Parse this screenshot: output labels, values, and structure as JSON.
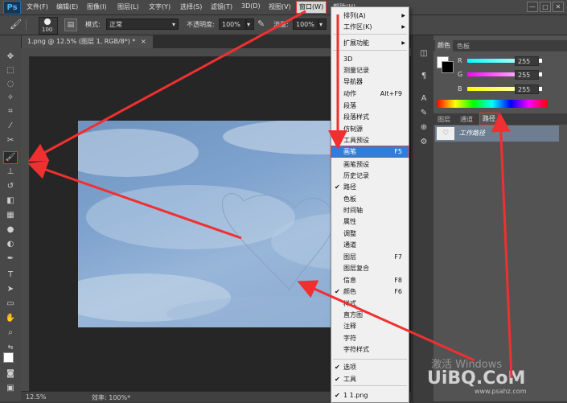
{
  "app": {
    "logo": "Ps"
  },
  "menubar": {
    "items": [
      "文件(F)",
      "编辑(E)",
      "图像(I)",
      "图层(L)",
      "文字(Y)",
      "选择(S)",
      "滤镜(T)",
      "3D(D)",
      "视图(V)",
      "窗口(W)",
      "帮助(H)"
    ]
  },
  "window_controls": {
    "minimize": "—",
    "restore": "□",
    "close": "✕"
  },
  "options": {
    "brush_size": "100",
    "mode_label": "模式:",
    "mode_value": "正常",
    "opacity_label": "不透明度:",
    "opacity_value": "100%",
    "flow_label": "流量:",
    "flow_value": "100%"
  },
  "document": {
    "tab": "1.png @ 12.5% (图层 1, RGB/8*) *",
    "tab_close": "×"
  },
  "status": {
    "zoom": "12.5%",
    "info": "效率: 100%*"
  },
  "window_menu": {
    "items": [
      {
        "label": "排列(A)",
        "shortcut": "",
        "checked": false,
        "submenu": true
      },
      {
        "label": "工作区(K)",
        "shortcut": "",
        "checked": false,
        "submenu": true
      },
      {
        "label": "扩展功能",
        "shortcut": "",
        "checked": false,
        "submenu": true
      },
      {
        "label": "3D",
        "shortcut": "",
        "checked": false
      },
      {
        "label": "测量记录",
        "shortcut": "",
        "checked": false
      },
      {
        "label": "导航器",
        "shortcut": "",
        "checked": false
      },
      {
        "label": "动作",
        "shortcut": "Alt+F9",
        "checked": false
      },
      {
        "label": "段落",
        "shortcut": "",
        "checked": false
      },
      {
        "label": "段落样式",
        "shortcut": "",
        "checked": false
      },
      {
        "label": "仿制源",
        "shortcut": "",
        "checked": false
      },
      {
        "label": "工具预设",
        "shortcut": "",
        "checked": false
      },
      {
        "label": "画笔",
        "shortcut": "F5",
        "checked": false,
        "highlighted": true
      },
      {
        "label": "画笔预设",
        "shortcut": "",
        "checked": false
      },
      {
        "label": "历史记录",
        "shortcut": "",
        "checked": false
      },
      {
        "label": "路径",
        "shortcut": "",
        "checked": true
      },
      {
        "label": "色板",
        "shortcut": "",
        "checked": false
      },
      {
        "label": "时间轴",
        "shortcut": "",
        "checked": false
      },
      {
        "label": "属性",
        "shortcut": "",
        "checked": false
      },
      {
        "label": "调整",
        "shortcut": "",
        "checked": false
      },
      {
        "label": "通道",
        "shortcut": "",
        "checked": false
      },
      {
        "label": "图层",
        "shortcut": "F7",
        "checked": false
      },
      {
        "label": "图层复合",
        "shortcut": "",
        "checked": false
      },
      {
        "label": "信息",
        "shortcut": "F8",
        "checked": false
      },
      {
        "label": "颜色",
        "shortcut": "F6",
        "checked": true
      },
      {
        "label": "样式",
        "shortcut": "",
        "checked": false
      },
      {
        "label": "直方图",
        "shortcut": "",
        "checked": false
      },
      {
        "label": "注释",
        "shortcut": "",
        "checked": false
      },
      {
        "label": "字符",
        "shortcut": "",
        "checked": false
      },
      {
        "label": "字符样式",
        "shortcut": "",
        "checked": false
      },
      {
        "label": "选项",
        "shortcut": "",
        "checked": true
      },
      {
        "label": "工具",
        "shortcut": "",
        "checked": true
      },
      {
        "label": "1 1.png",
        "shortcut": "",
        "checked": true
      }
    ]
  },
  "color_panel": {
    "tabs": [
      "颜色",
      "色板"
    ],
    "channels": [
      {
        "name": "R",
        "value": "255",
        "color": "#ff3030"
      },
      {
        "name": "G",
        "value": "255",
        "color": "#30c030"
      },
      {
        "name": "B",
        "value": "255",
        "color": "#3060ff"
      }
    ]
  },
  "paths_panel": {
    "tabs": [
      "图层",
      "通道",
      "路径"
    ],
    "path_name": "工作路径"
  },
  "watermark": {
    "line1": "激活 Windows",
    "line2": "UiBQ.CoM",
    "line3": "www.psahz.com"
  },
  "colors": {
    "highlight": "#2f7fd9",
    "annotation": "#f03030"
  }
}
